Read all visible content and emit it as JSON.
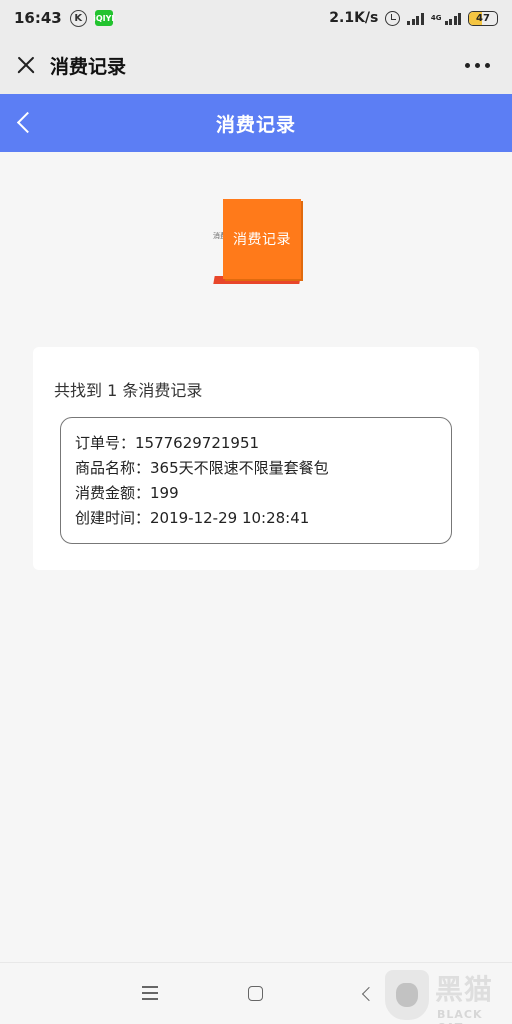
{
  "status_bar": {
    "time": "16:43",
    "k_badge": "K",
    "app_badge": "iQIYI",
    "net_speed": "2.1K/s",
    "network_type": "4G",
    "battery": "47",
    "battery_level": 0.47,
    "battery_color": "#f4c542"
  },
  "top_bar": {
    "title": "消费记录"
  },
  "header": {
    "title": "消费记录",
    "background": "#5c7ef4"
  },
  "logo": {
    "text": "消费记录",
    "side_text": "消费",
    "color": "#ff7a1a"
  },
  "results": {
    "summary": "共找到 1 条消费记录",
    "records": [
      {
        "order_line": "订单号：1577629721951",
        "product_line": "商品名称：365天不限速不限量套餐包",
        "amount_line": "消费金额：199",
        "created_line": "创建时间：2019-12-29 10:28:41"
      }
    ]
  },
  "watermark": {
    "cn": "黑猫",
    "en": "BLACK CAT"
  }
}
